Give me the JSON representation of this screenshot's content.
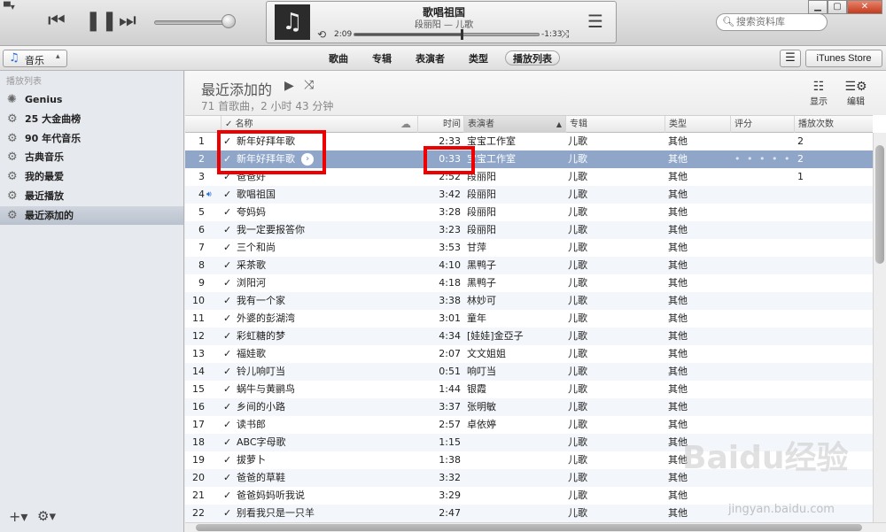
{
  "player": {
    "now_playing_title": "歌唱祖国",
    "now_playing_sub": "段丽阳 — 儿歌",
    "elapsed": "2:09",
    "remaining": "-1:33",
    "progress": 0.58
  },
  "search": {
    "placeholder": "搜索资料库"
  },
  "nav": {
    "source": "音乐",
    "tabs": [
      "歌曲",
      "专辑",
      "表演者",
      "类型",
      "播放列表"
    ],
    "active_tab": 4,
    "store": "iTunes Store"
  },
  "sidebar": {
    "heading": "播放列表",
    "items": [
      "Genius",
      "25 大金曲榜",
      "90 年代音乐",
      "古典音乐",
      "我的最爱",
      "最近播放",
      "最近添加的"
    ],
    "selected": 6
  },
  "playlist": {
    "title": "最近添加的",
    "summary": "71 首歌曲，2 小时 43 分钟",
    "show_label": "显示",
    "edit_label": "编辑"
  },
  "columns": {
    "name": "名称",
    "time": "时间",
    "artist": "表演者",
    "album": "专辑",
    "genre": "类型",
    "rating": "评分",
    "plays": "播放次数"
  },
  "rows": [
    {
      "n": "1",
      "name": "新年好拜年歌",
      "time": "2:33",
      "artist": "宝宝工作室",
      "album": "儿歌",
      "genre": "其他",
      "plays": "2"
    },
    {
      "n": "2",
      "name": "新年好拜年歌",
      "time": "0:33",
      "artist": "宝宝工作室",
      "album": "儿歌",
      "genre": "其他",
      "plays": "2",
      "selected": true
    },
    {
      "n": "3",
      "name": "爸爸好",
      "time": "2:52",
      "artist": "段丽阳",
      "album": "儿歌",
      "genre": "其他",
      "plays": "1"
    },
    {
      "n": "4",
      "name": "歌唱祖国",
      "time": "3:42",
      "artist": "段丽阳",
      "album": "儿歌",
      "genre": "其他",
      "plays": "",
      "playing": true
    },
    {
      "n": "5",
      "name": "夸妈妈",
      "time": "3:28",
      "artist": "段丽阳",
      "album": "儿歌",
      "genre": "其他",
      "plays": ""
    },
    {
      "n": "6",
      "name": "我一定要报答你",
      "time": "3:23",
      "artist": "段丽阳",
      "album": "儿歌",
      "genre": "其他",
      "plays": ""
    },
    {
      "n": "7",
      "name": "三个和尚",
      "time": "3:53",
      "artist": "甘萍",
      "album": "儿歌",
      "genre": "其他",
      "plays": ""
    },
    {
      "n": "8",
      "name": "采茶歌",
      "time": "4:10",
      "artist": "黑鸭子",
      "album": "儿歌",
      "genre": "其他",
      "plays": ""
    },
    {
      "n": "9",
      "name": "浏阳河",
      "time": "4:18",
      "artist": "黑鸭子",
      "album": "儿歌",
      "genre": "其他",
      "plays": ""
    },
    {
      "n": "10",
      "name": "我有一个家",
      "time": "3:38",
      "artist": "林妙可",
      "album": "儿歌",
      "genre": "其他",
      "plays": ""
    },
    {
      "n": "11",
      "name": "外婆的彭湖湾",
      "time": "3:01",
      "artist": "童年",
      "album": "儿歌",
      "genre": "其他",
      "plays": ""
    },
    {
      "n": "12",
      "name": "彩虹糖的梦",
      "time": "4:34",
      "artist": "[娃娃]金亞子",
      "album": "儿歌",
      "genre": "其他",
      "plays": ""
    },
    {
      "n": "13",
      "name": "福娃歌",
      "time": "2:07",
      "artist": "文文姐姐",
      "album": "儿歌",
      "genre": "其他",
      "plays": ""
    },
    {
      "n": "14",
      "name": "铃儿响叮当",
      "time": "0:51",
      "artist": "响叮当",
      "album": "儿歌",
      "genre": "其他",
      "plays": ""
    },
    {
      "n": "15",
      "name": "蜗牛与黄鹂鸟",
      "time": "1:44",
      "artist": "银霞",
      "album": "儿歌",
      "genre": "其他",
      "plays": ""
    },
    {
      "n": "16",
      "name": "乡间的小路",
      "time": "3:37",
      "artist": "张明敏",
      "album": "儿歌",
      "genre": "其他",
      "plays": ""
    },
    {
      "n": "17",
      "name": "读书郎",
      "time": "2:57",
      "artist": "卓依婷",
      "album": "儿歌",
      "genre": "其他",
      "plays": ""
    },
    {
      "n": "18",
      "name": "ABC字母歌",
      "time": "1:15",
      "artist": "",
      "album": "儿歌",
      "genre": "其他",
      "plays": ""
    },
    {
      "n": "19",
      "name": "拔萝卜",
      "time": "1:38",
      "artist": "",
      "album": "儿歌",
      "genre": "其他",
      "plays": ""
    },
    {
      "n": "20",
      "name": "爸爸的草鞋",
      "time": "3:32",
      "artist": "",
      "album": "儿歌",
      "genre": "其他",
      "plays": ""
    },
    {
      "n": "21",
      "name": "爸爸妈妈听我说",
      "time": "3:29",
      "artist": "",
      "album": "儿歌",
      "genre": "其他",
      "plays": ""
    },
    {
      "n": "22",
      "name": "别看我只是一只羊",
      "time": "2:47",
      "artist": "",
      "album": "儿歌",
      "genre": "其他",
      "plays": ""
    }
  ],
  "watermark": {
    "brand": "Baidu经验",
    "url": "jingyan.baidu.com"
  },
  "colors": {
    "accent": "#8fa6c9",
    "highlight": "#ef0000"
  }
}
